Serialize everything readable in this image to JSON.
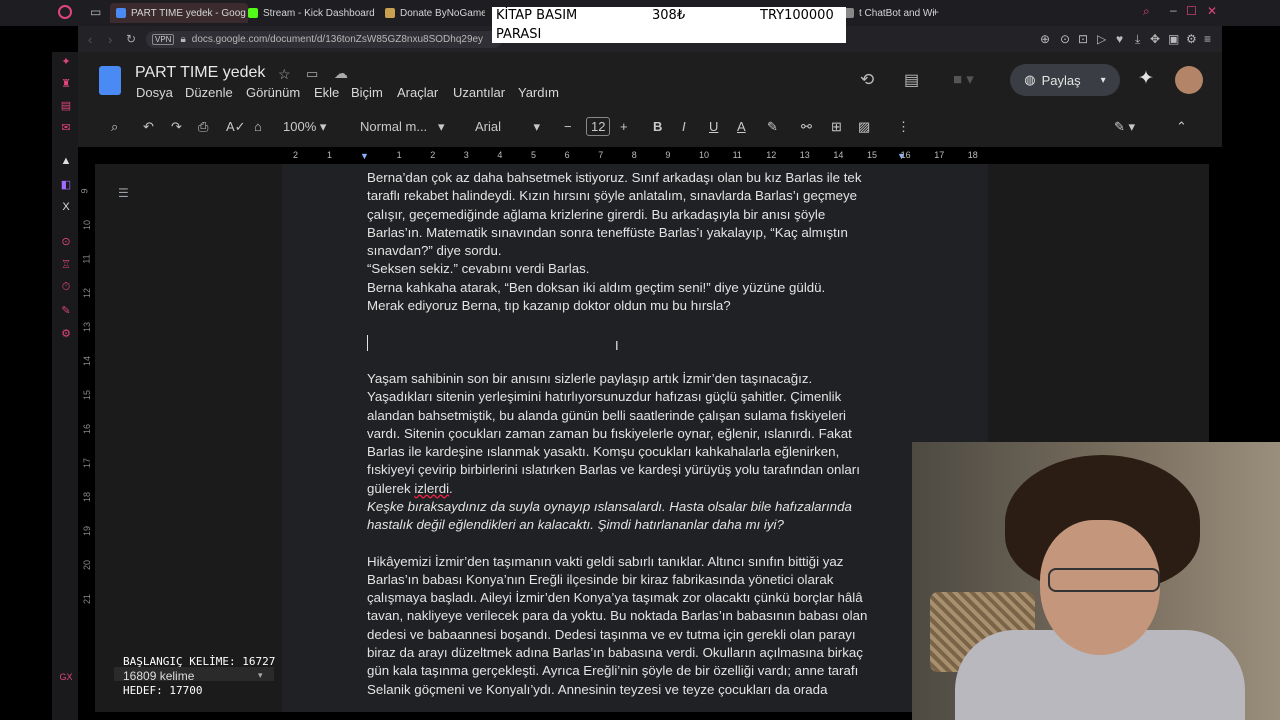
{
  "browser": {
    "tabs": [
      {
        "label": "PART TIME yedek - Goog",
        "color": "#4a8af4",
        "active": true
      },
      {
        "label": "Stream - Kick Dashboard",
        "color": "#53fc18"
      },
      {
        "label": "Donate ByNoGame -",
        "color": "#c8a050"
      },
      {
        "label": "t ChatBot and Wi",
        "color": "#888888"
      }
    ],
    "url": "docs.google.com/document/d/136tonZsW85GZ8nxu8SODhq29ey",
    "vpn_label": "VPN"
  },
  "banner": {
    "col1_line1": "KİTAP BASIM",
    "col1_line2": "PARASI",
    "current": "308₺",
    "goal": "TRY100000"
  },
  "docs": {
    "title": "PART TIME yedek",
    "menus": [
      "Dosya",
      "Düzenle",
      "Görünüm",
      "Ekle",
      "Biçim",
      "Araçlar",
      "Uzantılar",
      "Yardım"
    ],
    "share_label": "Paylaş",
    "toolbar": {
      "zoom": "100%",
      "style": "Normal m...",
      "font": "Arial",
      "font_size": "12"
    },
    "ruler_numbers": [
      "2",
      "1",
      "1",
      "2",
      "3",
      "4",
      "5",
      "6",
      "7",
      "8",
      "9",
      "10",
      "11",
      "12",
      "13",
      "14",
      "15",
      "16",
      "17",
      "18"
    ],
    "side_numbers": [
      "9",
      "10",
      "11",
      "12",
      "13",
      "14",
      "15",
      "16",
      "17",
      "18",
      "19",
      "20",
      "21"
    ],
    "lines": [
      {
        "text": "Berna’dan çok az daha bahsetmek istiyoruz. Sınıf arkadaşı olan bu kız Barlas ile tek"
      },
      {
        "text": "taraflı rekabet halindeydi. Kızın hırsını şöyle anlatalım, sınavlarda Barlas’ı geçmeye"
      },
      {
        "text": "çalışır, geçemediğinde ağlama krizlerine girerdi. Bu arkadaşıyla bir anısı şöyle"
      },
      {
        "text": "Barlas’ın. Matematik sınavından sonra teneffüste Barlas’ı yakalayıp, “Kaç almıştın"
      },
      {
        "text": "sınavdan?” diye sordu."
      },
      {
        "text": "“Seksen sekiz.” cevabını verdi Barlas."
      },
      {
        "text": "Berna kahkaha atarak, “Ben doksan iki aldım geçtim seni!” diye yüzüne güldü."
      },
      {
        "text": "Merak ediyoruz Berna, tıp kazanıp doktor oldun mu bu hırsla?"
      },
      {
        "text": ""
      },
      {
        "text": ""
      },
      {
        "text": ""
      },
      {
        "text": "Yaşam sahibinin son bir anısını sizlerle paylaşıp artık İzmir’den taşınacağız."
      },
      {
        "text": "Yaşadıkları sitenin yerleşimini hatırlıyorsunuzdur hafızası güçlü şahitler. Çimenlik"
      },
      {
        "text": "alandan bahsetmiştik, bu alanda günün belli saatlerinde çalışan sulama fıskiyeleri"
      },
      {
        "text": "vardı. Sitenin çocukları zaman zaman bu fıskiyelerle oynar, eğlenir, ıslanırdı. Fakat"
      },
      {
        "text": "Barlas ile kardeşine ıslanmak yasaktı. Komşu çocukları kahkahalarla eğlenirken,"
      },
      {
        "text": "fıskiyeyi çevirip birbirlerini ıslatırken Barlas ve kardeşi yürüyüş yolu tarafından onları"
      },
      {
        "text": "gülerek izlerdi.",
        "squiggle": "izlerdi"
      },
      {
        "text": "Keşke bıraksaydınız da suyla oynayıp ıslansalardı. Hasta olsalar bile hafızalarında",
        "italic": true
      },
      {
        "text": "hastalık değil eğlendikleri an kalacaktı. Şimdi hatırlananlar daha mı iyi?",
        "italic": true
      },
      {
        "text": ""
      },
      {
        "text": "Hikâyemizi İzmir’den taşımanın vakti geldi sabırlı tanıklar. Altıncı sınıfın bittiği yaz"
      },
      {
        "text": "Barlas’ın babası Konya’nın Ereğli ilçesinde bir kiraz fabrikasında yönetici olarak"
      },
      {
        "text": "çalışmaya başladı. Aileyi İzmir’den Konya’ya taşımak zor olacaktı çünkü borçlar hâlâ"
      },
      {
        "text": "tavan, nakliyeye verilecek para da yoktu. Bu noktada Barlas’ın babasının babası olan"
      },
      {
        "text": "dedesi ve babaannesi boşandı. Dedesi taşınma ve ev tutma için gerekli olan parayı"
      },
      {
        "text": "biraz da arayı düzeltmek adına Barlas’ın babasına verdi. Okulların açılmasına birkaç"
      },
      {
        "text": "gün kala taşınma gerçekleşti. Ayrıca Ereğli’nin şöyle de bir özelliği vardı; anne tarafı"
      },
      {
        "text": "Selanik göçmeni ve Konyalı’ydı. Annesinin teyzesi ve teyze çocukları da orada"
      }
    ]
  },
  "word_counter": {
    "start_label": "BAŞLANGIÇ KELİME: 16727",
    "current_label": "16809 kelime",
    "goal_label": "HEDEF: 17700"
  }
}
